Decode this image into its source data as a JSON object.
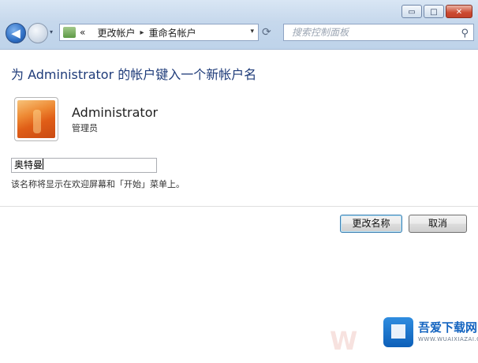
{
  "window": {
    "minimize": "▭",
    "maximize": "□",
    "close": "✕"
  },
  "nav": {
    "back_icon": "◀",
    "dropdown_icon": "▾",
    "refresh_icon": "⟳"
  },
  "address": {
    "prefix": "«",
    "crumbs": [
      "更改帐户",
      "重命名帐户"
    ],
    "separator": "▸",
    "dropdown_icon": "▾"
  },
  "search": {
    "placeholder": "搜索控制面板",
    "icon": "⚲"
  },
  "content": {
    "heading": "为 Administrator 的帐户键入一个新帐户名",
    "account_name": "Administrator",
    "account_role": "管理员",
    "new_name_value": "奥特曼",
    "hint": "该名称将显示在欢迎屏幕和「开始」菜单上。"
  },
  "buttons": {
    "rename": "更改名称",
    "cancel": "取消"
  },
  "watermark": {
    "title": "吾爱下载网",
    "subtitle": "WWW.WUAIXIAZAI.COM",
    "faint": "W"
  },
  "colors": {
    "heading": "#1e3b79",
    "titlebar": "#c6d8ec",
    "primary_border": "#3c7fb1"
  }
}
